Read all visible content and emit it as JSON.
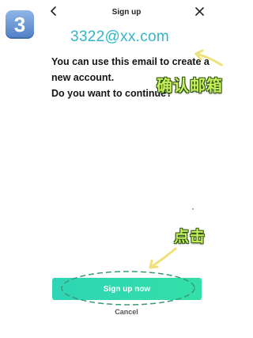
{
  "step_badge": "3",
  "header": {
    "title": "Sign up"
  },
  "annotations": {
    "email": "3322@xx.com",
    "confirm_email": "确认邮箱",
    "click_here": "点击"
  },
  "message": {
    "line1": "You can use this email to create a",
    "line2": "new account.",
    "line3": "Do you want to continue?"
  },
  "actions": {
    "primary_label": "Sign up now",
    "cancel_label": "Cancel"
  },
  "colors": {
    "primary_button": "#2ed5b6",
    "email_annotation": "#2fb4c8",
    "annotation_text": "#c6ef5a",
    "arrow": "#f0e07a",
    "badge": "#5a8ad0"
  },
  "icons": {
    "back": "chevron-left-icon",
    "close": "close-icon"
  }
}
